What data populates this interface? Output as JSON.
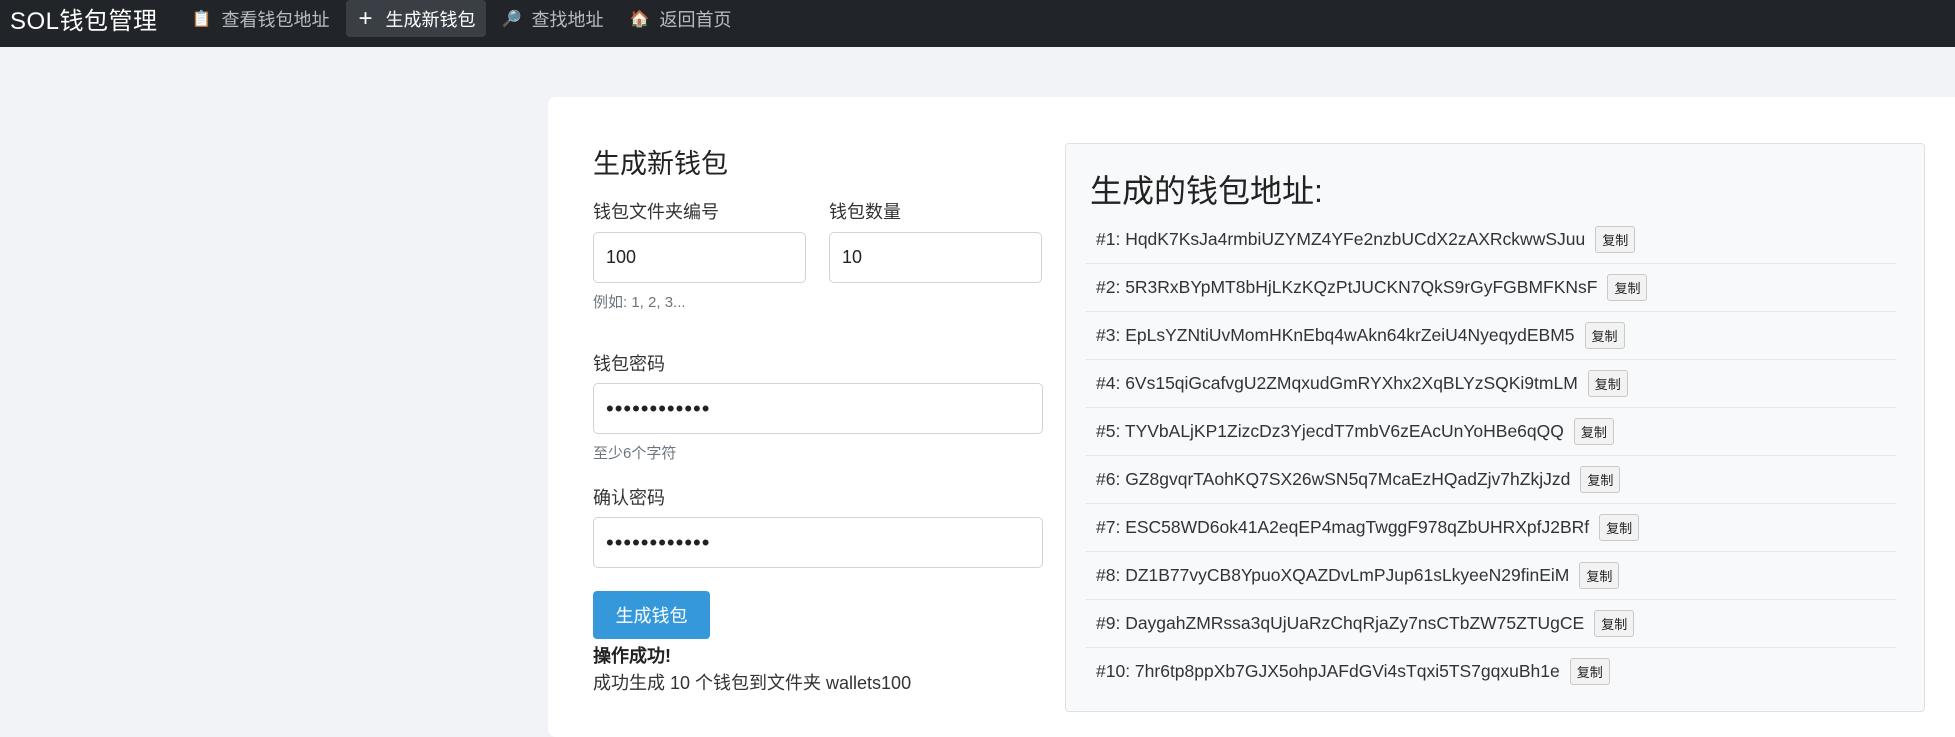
{
  "nav": {
    "brand": "SOL钱包管理",
    "items": [
      {
        "icon": "clipboard-icon",
        "glyph": "📋",
        "label": "查看钱包地址",
        "active": false
      },
      {
        "icon": "plus-icon",
        "glyph": "+",
        "label": "生成新钱包",
        "active": true
      },
      {
        "icon": "magnifier-icon",
        "glyph": "🔎",
        "label": "查找地址",
        "active": false
      },
      {
        "icon": "home-icon",
        "glyph": "🏠",
        "label": "返回首页",
        "active": false
      }
    ]
  },
  "form": {
    "title": "生成新钱包",
    "folder_label": "钱包文件夹编号",
    "folder_value": "100",
    "folder_hint": "例如: 1, 2, 3...",
    "count_label": "钱包数量",
    "count_value": "10",
    "password_label": "钱包密码",
    "password_value": "••••••••••••",
    "password_hint": "至少6个字符",
    "confirm_label": "确认密码",
    "confirm_value": "••••••••••••",
    "submit_label": "生成钱包",
    "success_title": "操作成功!",
    "success_message": "成功生成 10 个钱包到文件夹 wallets100"
  },
  "results": {
    "title": "生成的钱包地址:",
    "copy_label": "复制",
    "addresses": [
      "#1: HqdK7KsJa4rmbiUZYMZ4YFe2nzbUCdX2zAXRckwwSJuu",
      "#2: 5R3RxBYpMT8bHjLKzKQzPtJUCKN7QkS9rGyFGBMFKNsF",
      "#3: EpLsYZNtiUvMomHKnEbq4wAkn64krZeiU4NyeqydEBM5",
      "#4: 6Vs15qiGcafvgU2ZMqxudGmRYXhx2XqBLYzSQKi9tmLM",
      "#5: TYVbALjKP1ZizcDz3YjecdT7mbV6zEAcUnYoHBe6qQQ",
      "#6: GZ8gvqrTAohKQ7SX26wSN5q7McaEzHQadZjv7hZkjJzd",
      "#7: ESC58WD6ok41A2eqEP4magTwggF978qZbUHRXpfJ2BRf",
      "#8: DZ1B77vyCB8YpuoXQAZDvLmPJup61sLkyeeN29finEiM",
      "#9: DaygahZMRssa3qUjUaRzChqRjaZy7nsCTbZW75ZTUgCE",
      "#10: 7hr6tp8ppXb7GJX5ohpJAFdGVi4sTqxi5TS7gqxuBh1e"
    ]
  },
  "colors": {
    "navbar": "#212529",
    "primary_button": "#3498db",
    "page_background": "#f1f3f6"
  }
}
